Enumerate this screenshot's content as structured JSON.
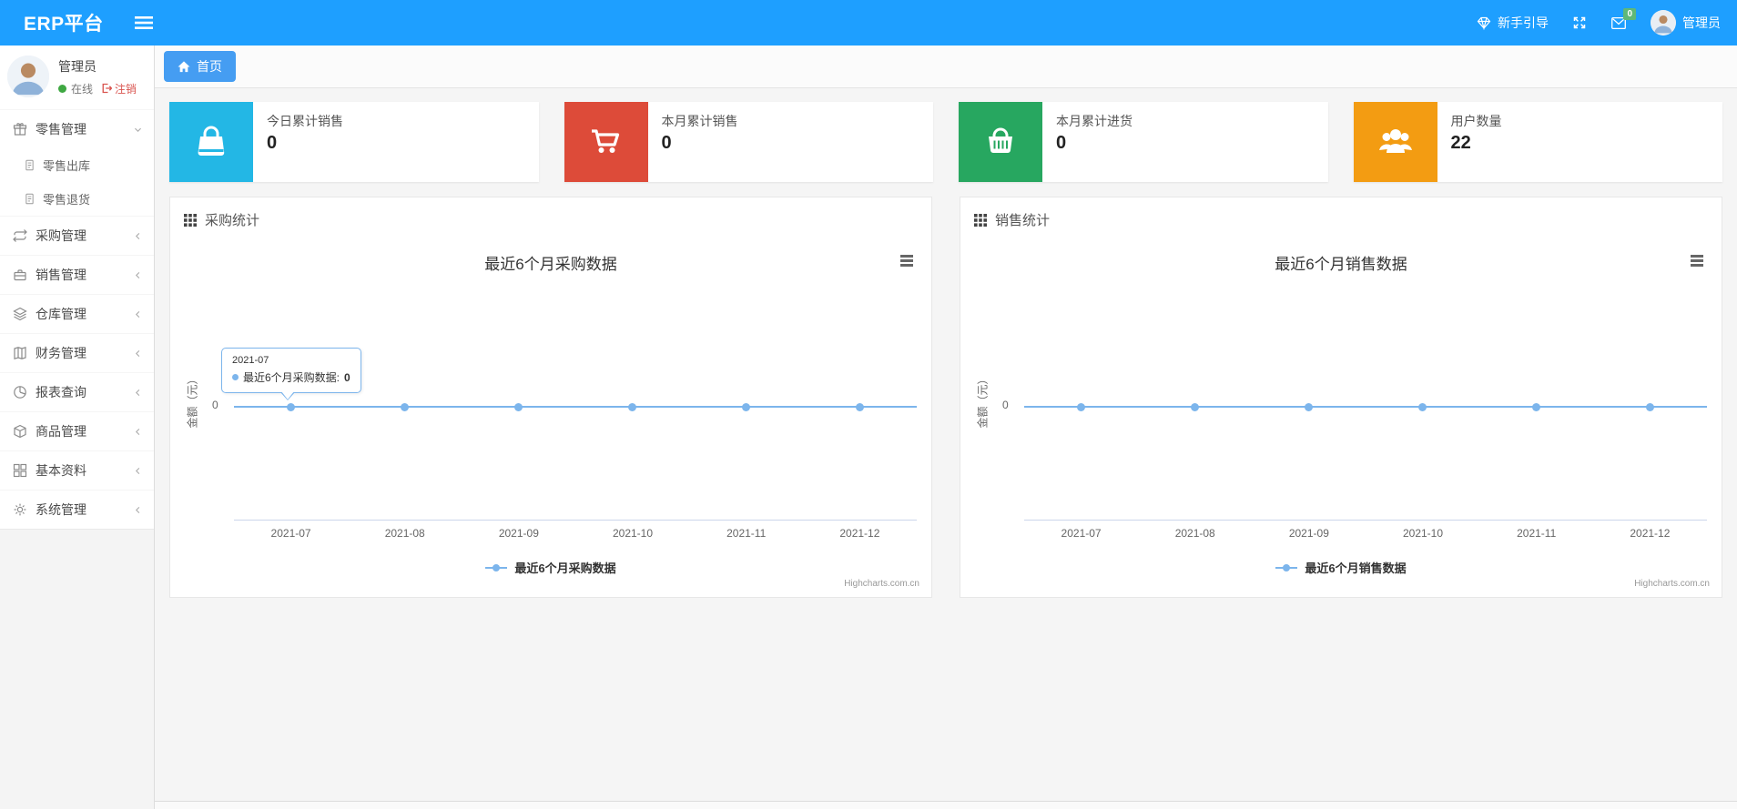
{
  "colors": {
    "navbar_blue": "#1E9FFF",
    "tab_blue": "#459df2",
    "chart_line_blue": "#7cb5ec",
    "badge_green": "#5FB878",
    "card_cyan": "#23b7e5",
    "card_red": "#dd4b39",
    "card_green": "#27a760",
    "card_orange": "#f39c12"
  },
  "navbar": {
    "brand": "ERP平台",
    "guide_label": "新手引导",
    "message_badge": "0",
    "user_label": "管理员"
  },
  "sidebar": {
    "user": {
      "name": "管理员",
      "status": "在线",
      "logout": "注销"
    },
    "menu": [
      {
        "label": "零售管理"
      },
      {
        "label": "零售出库"
      },
      {
        "label": "零售退货"
      },
      {
        "label": "采购管理"
      },
      {
        "label": "销售管理"
      },
      {
        "label": "仓库管理"
      },
      {
        "label": "财务管理"
      },
      {
        "label": "报表查询"
      },
      {
        "label": "商品管理"
      },
      {
        "label": "基本资料"
      },
      {
        "label": "系统管理"
      }
    ]
  },
  "tabs": {
    "home": "首页"
  },
  "stat_cards": [
    {
      "label": "今日累计销售",
      "value": "0",
      "icon": "bag-icon",
      "color": "#23b7e5"
    },
    {
      "label": "本月累计销售",
      "value": "0",
      "icon": "cart-icon",
      "color": "#dd4b39"
    },
    {
      "label": "本月累计进货",
      "value": "0",
      "icon": "basket-icon",
      "color": "#27a760"
    },
    {
      "label": "用户数量",
      "value": "22",
      "icon": "users-icon",
      "color": "#f39c12"
    }
  ],
  "panels": [
    {
      "title": "采购统计"
    },
    {
      "title": "销售统计"
    }
  ],
  "chart_data": [
    {
      "type": "line",
      "title": "最近6个月采购数据",
      "x": [
        "2021-07",
        "2021-08",
        "2021-09",
        "2021-10",
        "2021-11",
        "2021-12"
      ],
      "series": [
        {
          "name": "最近6个月采购数据",
          "values": [
            0,
            0,
            0,
            0,
            0,
            0
          ]
        }
      ],
      "ylabel": "金额（元）",
      "ytick_label": "0",
      "ylim": [
        -1,
        1
      ],
      "grid": false,
      "legend_position": "bottom",
      "credits": "Highcharts.com.cn",
      "tooltip": {
        "date": "2021-07",
        "text": "最近6个月采购数据:",
        "value": "0"
      }
    },
    {
      "type": "line",
      "title": "最近6个月销售数据",
      "x": [
        "2021-07",
        "2021-08",
        "2021-09",
        "2021-10",
        "2021-11",
        "2021-12"
      ],
      "series": [
        {
          "name": "最近6个月销售数据",
          "values": [
            0,
            0,
            0,
            0,
            0,
            0
          ]
        }
      ],
      "ylabel": "金额（元）",
      "ytick_label": "0",
      "ylim": [
        -1,
        1
      ],
      "grid": false,
      "legend_position": "bottom",
      "credits": "Highcharts.com.cn"
    }
  ]
}
